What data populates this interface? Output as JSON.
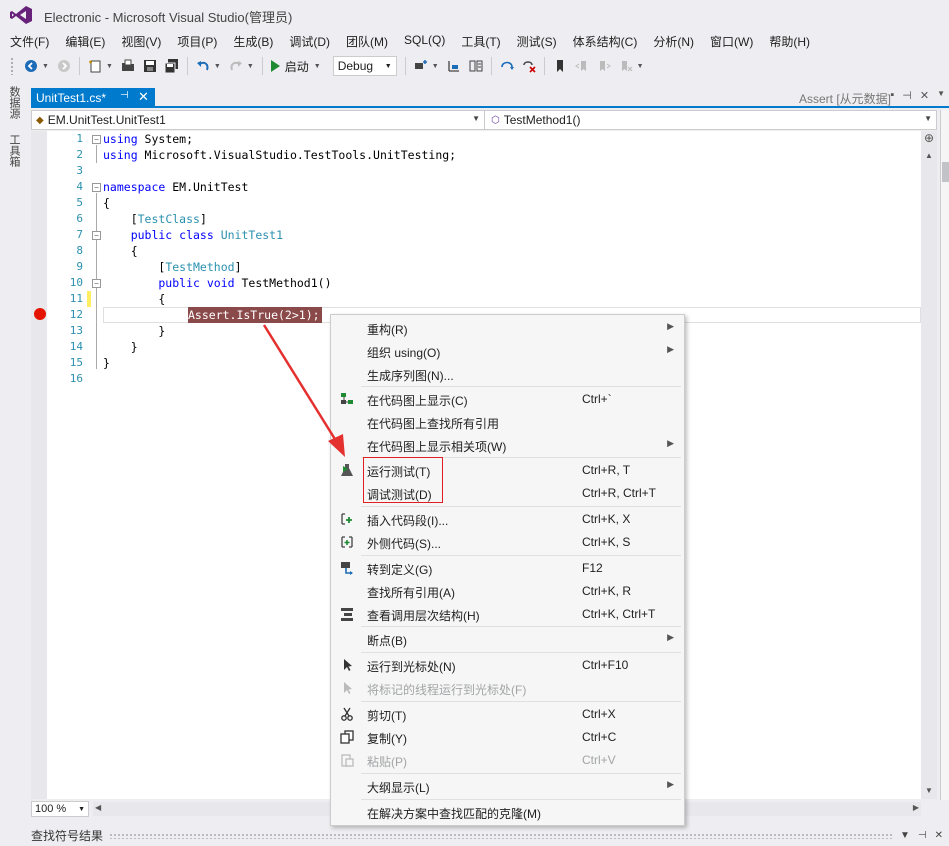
{
  "window": {
    "title": "Electronic - Microsoft Visual Studio(管理员)"
  },
  "menu": [
    "文件(F)",
    "编辑(E)",
    "视图(V)",
    "项目(P)",
    "生成(B)",
    "调试(D)",
    "团队(M)",
    "SQL(Q)",
    "工具(T)",
    "测试(S)",
    "体系结构(C)",
    "分析(N)",
    "窗口(W)",
    "帮助(H)"
  ],
  "toolbar": {
    "start_label": "启动",
    "config": "Debug"
  },
  "left_dock": {
    "tab1": "数据源",
    "tab2": "工具箱"
  },
  "tabs": {
    "active": "UnitTest1.cs*",
    "preview": "Assert [从元数据]"
  },
  "nav": {
    "class": "EM.UnitTest.UnitTest1",
    "method": "TestMethod1()"
  },
  "code": {
    "line_numbers": [
      "1",
      "2",
      "3",
      "4",
      "5",
      "6",
      "7",
      "8",
      "9",
      "10",
      "11",
      "12",
      "13",
      "14",
      "15",
      "16"
    ],
    "l1_kw": "using",
    "l1_rest": " System;",
    "l2_kw": "using",
    "l2_rest": " Microsoft.VisualStudio.TestTools.UnitTesting;",
    "l4_kw": "namespace",
    "l4_rest": " EM.UnitTest",
    "l5": "{",
    "l6_open": "    [",
    "l6_type": "TestClass",
    "l6_close": "]",
    "l7_kw": "    public class ",
    "l7_type": "UnitTest1",
    "l8": "    {",
    "l9_open": "        [",
    "l9_type": "TestMethod",
    "l9_close": "]",
    "l10_kw": "        public void",
    "l10_rest": " TestMethod1()",
    "l11": "        {",
    "l12_sel": "Assert.IsTrue(2>1);",
    "l13": "        }",
    "l14": "    }",
    "l15": "}"
  },
  "zoom": "100 %",
  "find_panel": {
    "title": "查找符号结果"
  },
  "context_menu": {
    "items": [
      {
        "label": "重构(R)",
        "shortcut": ""
      },
      {
        "label": "组织 using(O)",
        "shortcut": ""
      },
      {
        "label": "生成序列图(N)...",
        "shortcut": ""
      },
      {
        "label": "在代码图上显示(C)",
        "shortcut": "Ctrl+`"
      },
      {
        "label": "在代码图上查找所有引用",
        "shortcut": ""
      },
      {
        "label": "在代码图上显示相关项(W)",
        "shortcut": ""
      },
      {
        "label": "运行测试(T)",
        "shortcut": "Ctrl+R, T"
      },
      {
        "label": "调试测试(D)",
        "shortcut": "Ctrl+R, Ctrl+T"
      },
      {
        "label": "插入代码段(I)...",
        "shortcut": "Ctrl+K, X"
      },
      {
        "label": "外侧代码(S)...",
        "shortcut": "Ctrl+K, S"
      },
      {
        "label": "转到定义(G)",
        "shortcut": "F12"
      },
      {
        "label": "查找所有引用(A)",
        "shortcut": "Ctrl+K, R"
      },
      {
        "label": "查看调用层次结构(H)",
        "shortcut": "Ctrl+K, Ctrl+T"
      },
      {
        "label": "断点(B)",
        "shortcut": ""
      },
      {
        "label": "运行到光标处(N)",
        "shortcut": "Ctrl+F10"
      },
      {
        "label": "将标记的线程运行到光标处(F)",
        "shortcut": ""
      },
      {
        "label": "剪切(T)",
        "shortcut": "Ctrl+X"
      },
      {
        "label": "复制(Y)",
        "shortcut": "Ctrl+C"
      },
      {
        "label": "粘贴(P)",
        "shortcut": "Ctrl+V"
      },
      {
        "label": "大纲显示(L)",
        "shortcut": ""
      },
      {
        "label": "在解决方案中查找匹配的克隆(M)",
        "shortcut": ""
      }
    ]
  },
  "colors": {
    "accent": "#007acc",
    "breakpoint": "#e51400",
    "selection": "#8b4a4a",
    "highlight_box": "#e02020",
    "annotation_arrow": "#e53030"
  }
}
